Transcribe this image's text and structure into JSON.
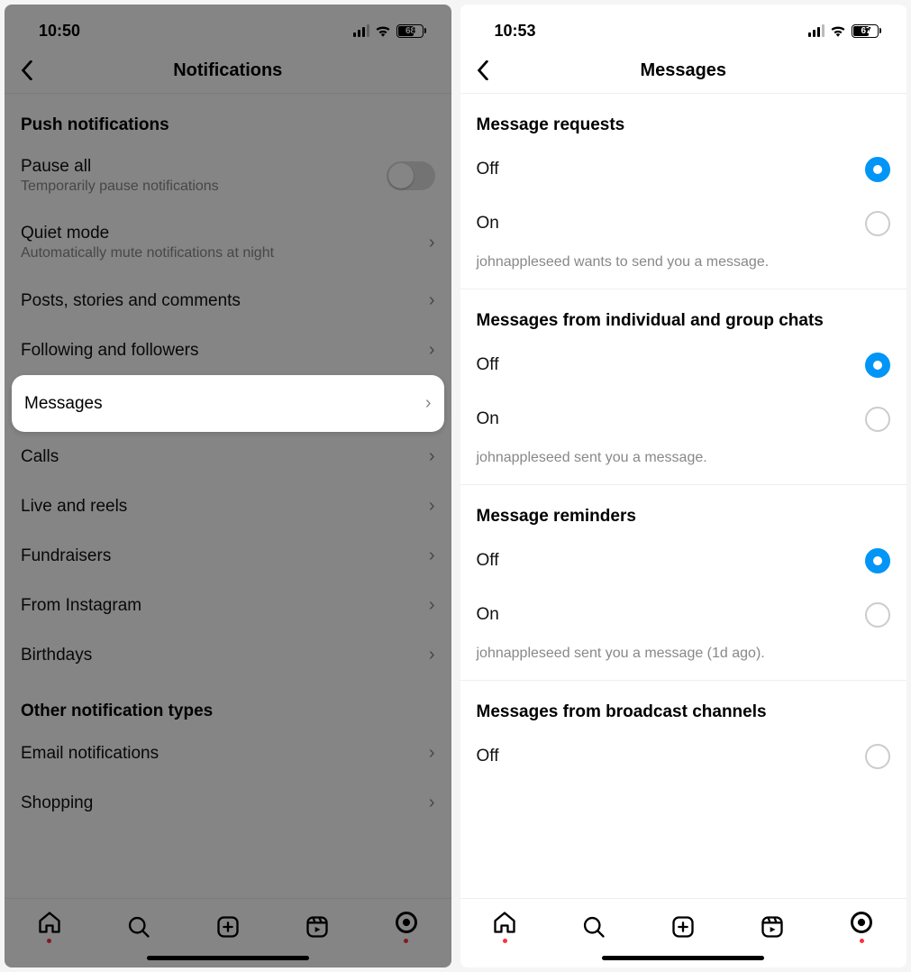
{
  "left": {
    "status": {
      "time": "10:50",
      "battery": "68"
    },
    "header_title": "Notifications",
    "section1_title": "Push notifications",
    "pause_all": {
      "label": "Pause all",
      "sub": "Temporarily pause notifications"
    },
    "quiet_mode": {
      "label": "Quiet mode",
      "sub": "Automatically mute notifications at night"
    },
    "items": {
      "posts": "Posts, stories and comments",
      "following": "Following and followers",
      "messages": "Messages",
      "calls": "Calls",
      "live": "Live and reels",
      "fundraisers": "Fundraisers",
      "from_ig": "From Instagram",
      "birthdays": "Birthdays"
    },
    "section2_title": "Other notification types",
    "other": {
      "email": "Email notifications",
      "shopping": "Shopping"
    }
  },
  "right": {
    "status": {
      "time": "10:53",
      "battery": "67"
    },
    "header_title": "Messages",
    "groups": {
      "requests": {
        "title": "Message requests",
        "off": "Off",
        "on": "On",
        "hint": "johnappleseed wants to send you a message."
      },
      "chats": {
        "title": "Messages from individual and group chats",
        "off": "Off",
        "on": "On",
        "hint": "johnappleseed sent you a message."
      },
      "reminders": {
        "title": "Message reminders",
        "off": "Off",
        "on": "On",
        "hint": "johnappleseed sent you a message (1d ago)."
      },
      "broadcast": {
        "title": "Messages from broadcast channels",
        "off": "Off"
      }
    }
  }
}
